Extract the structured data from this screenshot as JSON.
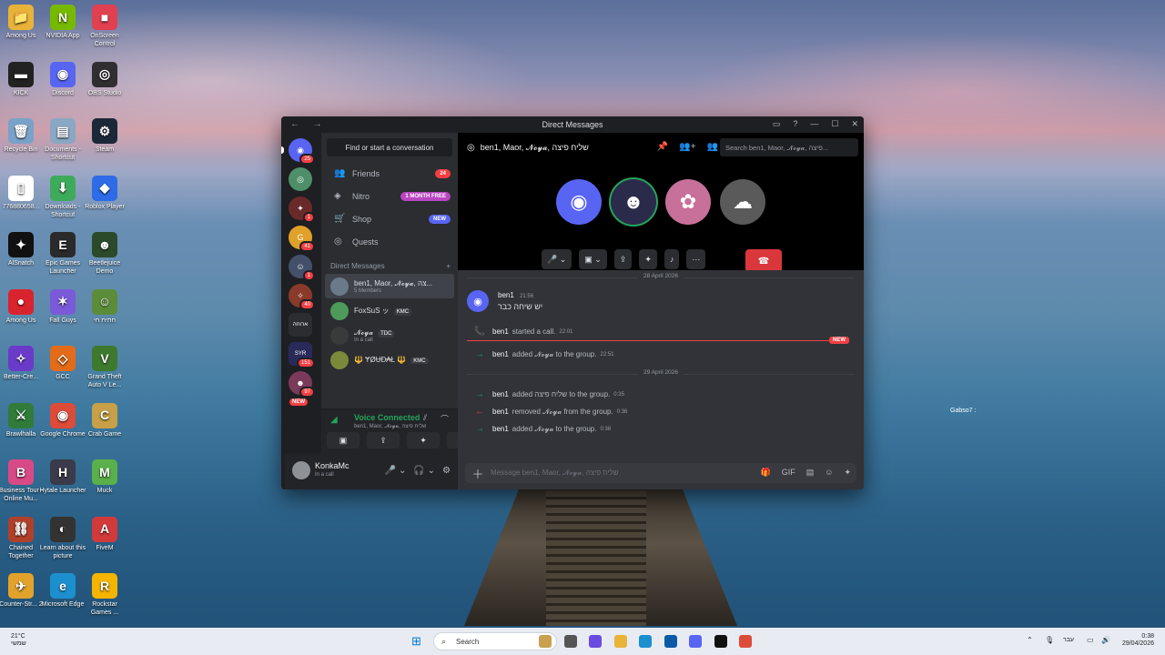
{
  "desktop": {
    "icons": [
      {
        "label": "Among Us",
        "glyph": "📁",
        "color": "#e8b339"
      },
      {
        "label": "NVIDIA App",
        "glyph": "N",
        "color": "#76b900"
      },
      {
        "label": "OnScreen Control",
        "glyph": "■",
        "color": "#e04050"
      },
      {
        "label": "KICK",
        "glyph": "▬",
        "color": "#222"
      },
      {
        "label": "Discord",
        "glyph": "◉",
        "color": "#5865f2"
      },
      {
        "label": "OBS Studio",
        "glyph": "◎",
        "color": "#302e31"
      },
      {
        "label": "Recycle Bin",
        "glyph": "🗑",
        "color": "#7aa2c8"
      },
      {
        "label": "Documents - Shortcut",
        "glyph": "▤",
        "color": "#8aa7c3"
      },
      {
        "label": "Steam",
        "glyph": "⚙",
        "color": "#1b2838"
      },
      {
        "label": "776880658...",
        "glyph": "▯",
        "color": "#ffffff"
      },
      {
        "label": "Downloads - Shortcut",
        "glyph": "⬇",
        "color": "#3eaa5c"
      },
      {
        "label": "Roblox Player",
        "glyph": "◆",
        "color": "#2e6be6"
      },
      {
        "label": "AlSnatch",
        "glyph": "✦",
        "color": "#111"
      },
      {
        "label": "Epic Games Launcher",
        "glyph": "E",
        "color": "#2a2a2a"
      },
      {
        "label": "Beetlejuice Demo",
        "glyph": "☻",
        "color": "#2a4a2a"
      },
      {
        "label": "Among Us",
        "glyph": "●",
        "color": "#d9232e"
      },
      {
        "label": "Fall Guys",
        "glyph": "✶",
        "color": "#7a5ad8"
      },
      {
        "label": "חתית חי",
        "glyph": "☺",
        "color": "#5b8c3a"
      },
      {
        "label": "Better-Cre...",
        "glyph": "✧",
        "color": "#6a3ac9"
      },
      {
        "label": "GCC",
        "glyph": "◇",
        "color": "#e46b18"
      },
      {
        "label": "Grand Theft Auto V Le...",
        "glyph": "V",
        "color": "#3d7a2e"
      },
      {
        "label": "Brawlhalla",
        "glyph": "⚔",
        "color": "#2f7c3a"
      },
      {
        "label": "Google Chrome",
        "glyph": "◉",
        "color": "#dd4b39"
      },
      {
        "label": "Crab Game",
        "glyph": "C",
        "color": "#c7a047"
      },
      {
        "label": "Business Tour - Online Mu...",
        "glyph": "B",
        "color": "#d84a86"
      },
      {
        "label": "Hytale Launcher",
        "glyph": "H",
        "color": "#3a3a4a"
      },
      {
        "label": "Muck",
        "glyph": "M",
        "color": "#5ab04a"
      },
      {
        "label": "Chained Together",
        "glyph": "⛓",
        "color": "#b0402a"
      },
      {
        "label": "Learn about this picture",
        "glyph": "◐",
        "color": "#333"
      },
      {
        "label": "FiveM",
        "glyph": "A",
        "color": "#d23a3a"
      },
      {
        "label": "Counter-Str... 2",
        "glyph": "✈",
        "color": "#e2a22b"
      },
      {
        "label": "Microsoft Edge",
        "glyph": "e",
        "color": "#1c8fcf"
      },
      {
        "label": "Rockstar Games ...",
        "glyph": "R",
        "color": "#f5b400"
      }
    ],
    "note": "Gabso7 :"
  },
  "window": {
    "title": "Direct Messages",
    "nav_glyph": "← →",
    "controls": [
      "▭",
      "?",
      "—",
      "☐",
      "✕"
    ]
  },
  "guilds": [
    {
      "glyph": "◉",
      "color": "#5865f2",
      "badge": "25"
    },
    {
      "glyph": "◎",
      "color": "#4e8f6a",
      "badge": ""
    },
    {
      "glyph": "✦",
      "color": "#6a2a2a",
      "badge": "1"
    },
    {
      "glyph": "G",
      "color": "#e0a02a",
      "badge": "41"
    },
    {
      "glyph": "☺",
      "color": "#44506a",
      "badge": "1"
    },
    {
      "glyph": "✧",
      "color": "#8a3a2a",
      "badge": "40"
    },
    {
      "glyph": "ארוחה",
      "color": "#2b2d31",
      "badge": ""
    },
    {
      "glyph": "SYR",
      "color": "#2a2a5a",
      "badge": "151"
    },
    {
      "glyph": "☻",
      "color": "#7a3a5a",
      "badge": "97"
    }
  ],
  "guild_new_label": "NEW",
  "sidebar": {
    "find_label": "Find or start a conversation",
    "nav": [
      {
        "icon": "👥",
        "label": "Friends",
        "pill": "24",
        "pill_color": "#f23f43"
      },
      {
        "icon": "◈",
        "label": "Nitro",
        "pill": "1 MONTH FREE",
        "pill_color": "#b845c1"
      },
      {
        "icon": "🛒",
        "label": "Shop",
        "pill": "NEW",
        "pill_color": "#5865f2"
      },
      {
        "icon": "◎",
        "label": "Quests",
        "pill": "",
        "pill_color": ""
      }
    ],
    "dm_header": "Direct Messages",
    "dm_add": "+",
    "dms": [
      {
        "name": "ben1, Maor, 𝓝𝓸𝔂𝓪, צה...",
        "sub": "5 Members",
        "tag": "",
        "color": "#6a7a8a",
        "active": true
      },
      {
        "name": "FoxSuS ッ",
        "sub": "",
        "tag": "KMC",
        "color": "#4e9a5a",
        "active": false
      },
      {
        "name": "𝓝𝓸𝔂𝓪",
        "sub": "In a call",
        "tag": "TDC",
        "color": "#3a3a3a",
        "active": false
      },
      {
        "name": "🔱 ɎØɄĐ₳Ł 🔱",
        "sub": "",
        "tag": "KMC",
        "color": "#7a8a3a",
        "active": false
      }
    ]
  },
  "voice": {
    "status": "Voice Connected",
    "channel": "ben1, Maor, 𝓝𝓸𝔂𝓪, שליח פיצה",
    "buttons": [
      "▣",
      "⇪",
      "✦",
      "♪"
    ]
  },
  "user": {
    "name": "KonkaMc",
    "status": "In a call",
    "controls": [
      "🎤 ⌄",
      "🎧 ⌄",
      "⚙"
    ]
  },
  "channel": {
    "title": "ben1, Maor, 𝓝𝓸𝔂𝓪, שליח פיצה",
    "header_icons": [
      "📌",
      "👥+",
      "👥"
    ],
    "search_placeholder": "Search ben1, Maor, 𝓝𝓸𝔂𝓪, פיצה..."
  },
  "call": {
    "participants": [
      {
        "glyph": "◉",
        "color": "#5865f2",
        "speaking": false
      },
      {
        "glyph": "☻",
        "color": "#2a2a4a",
        "speaking": true
      },
      {
        "glyph": "✿",
        "color": "#c7709a",
        "speaking": false
      },
      {
        "glyph": "☁",
        "color": "#5a5a5a",
        "speaking": false
      }
    ],
    "controls": [
      "🎤 ⌄",
      "▣ ⌄",
      "⇪",
      "✦",
      "♪",
      "⋯"
    ],
    "end_glyph": "☎"
  },
  "messages": {
    "date1": "28 April 2026",
    "date2": "29 April 2026",
    "new_badge": "NEW",
    "first_author": "ben1",
    "first_time": "21:56",
    "first_text": "יש שיחה כבר",
    "events": [
      {
        "arrow": "📞",
        "color": "#23a55a",
        "actor": "ben1",
        "text": "started a call.",
        "time": "22:01"
      },
      {
        "arrow": "→",
        "color": "#23a55a",
        "actor": "ben1",
        "text": "added 𝓝𝓸𝔂𝓪 to the group.",
        "time": "22:51"
      },
      {
        "arrow": "→",
        "color": "#23a55a",
        "actor": "ben1",
        "text": "added שליח פיצה to the group.",
        "time": "0:35"
      },
      {
        "arrow": "←",
        "color": "#f23f43",
        "actor": "ben1",
        "text": "removed 𝓝𝓸𝔂𝓪 from the group.",
        "time": "0:36"
      },
      {
        "arrow": "→",
        "color": "#23a55a",
        "actor": "ben1",
        "text": "added 𝓝𝓸𝔂𝓪 to the group.",
        "time": "0:36"
      }
    ]
  },
  "composer": {
    "placeholder": "Message ben1, Maor, 𝓝𝓸𝔂𝓪, שליח פיצה",
    "icons": [
      "🎁",
      "GIF",
      "▤",
      "☺",
      "✦"
    ]
  },
  "taskbar": {
    "temp": "21°C",
    "weather_sub": "שמשי",
    "search_label": "Search",
    "lang": "עבר",
    "time": "0:38",
    "date": "29/04/2026"
  }
}
